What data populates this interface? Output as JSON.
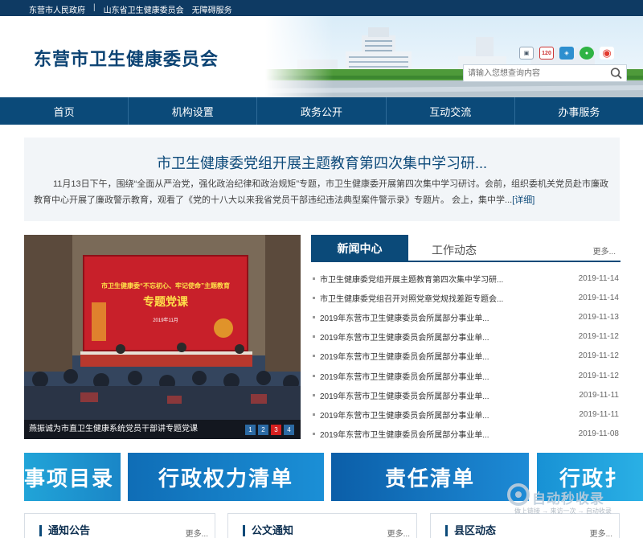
{
  "topbar": {
    "links": [
      "东营市人民政府",
      "|",
      "山东省卫生健康委员会",
      "无障碍服务"
    ]
  },
  "header": {
    "site_title": "东营市卫生健康委员会",
    "search_placeholder": "请输入您想查询内容",
    "social_icons": [
      "mobile-icon",
      "hotline-120-icon",
      "app-icon",
      "wechat-icon",
      "weibo-icon"
    ],
    "hotline_label": "120"
  },
  "nav": {
    "items": [
      "首页",
      "机构设置",
      "政务公开",
      "互动交流",
      "办事服务"
    ]
  },
  "feature": {
    "title": "市卫生健康委党组开展主题教育第四次集中学习研...",
    "summary": "11月13日下午，围绕“全面从严治党，强化政治纪律和政治规矩”专题，市卫生健康委开展第四次集中学习研讨。会前，组织委机关党员赴市廉政教育中心开展了廉政警示教育，观看了《党的十八大以来我省党员干部违纪违法典型案件警示录》专题片。 会上，集中学...",
    "more": "[详细]"
  },
  "photo": {
    "caption": "燕振诚为市直卫生健康系统党员干部讲专题党课",
    "banner_line1": "市卫生健康委“不忘初心、牢记使命”主题教育",
    "banner_line2": "专题党课",
    "banner_date": "2019年11月",
    "pages": [
      "1",
      "2",
      "3",
      "4"
    ],
    "active_page": "3"
  },
  "news": {
    "tab_active": "新闻中心",
    "tab_inactive": "工作动态",
    "more": "更多...",
    "items": [
      {
        "title": "市卫生健康委党组开展主题教育第四次集中学习研...",
        "date": "2019-11-14"
      },
      {
        "title": "市卫生健康委党组召开对照党章党规找差距专题会...",
        "date": "2019-11-14"
      },
      {
        "title": "2019年东营市卫生健康委员会所属部分事业单...",
        "date": "2019-11-13"
      },
      {
        "title": "2019年东营市卫生健康委员会所属部分事业单...",
        "date": "2019-11-12"
      },
      {
        "title": "2019年东营市卫生健康委员会所属部分事业单...",
        "date": "2019-11-12"
      },
      {
        "title": "2019年东营市卫生健康委员会所属部分事业单...",
        "date": "2019-11-12"
      },
      {
        "title": "2019年东营市卫生健康委员会所属部分事业单...",
        "date": "2019-11-11"
      },
      {
        "title": "2019年东营市卫生健康委员会所属部分事业单...",
        "date": "2019-11-11"
      },
      {
        "title": "2019年东营市卫生健康委员会所属部分事业单...",
        "date": "2019-11-08"
      }
    ]
  },
  "banners": [
    "事项目录",
    "行政权力清单",
    "责任清单",
    "行政扌"
  ],
  "bottom_boxes": [
    {
      "title": "通知公告",
      "more": "更多..."
    },
    {
      "title": "公文通知",
      "more": "更多..."
    },
    {
      "title": "县区动态",
      "more": "更多..."
    }
  ],
  "watermark": {
    "title": "自动秒收录",
    "subtitle": "做上链接 → 来访一次 → 自动收录"
  }
}
